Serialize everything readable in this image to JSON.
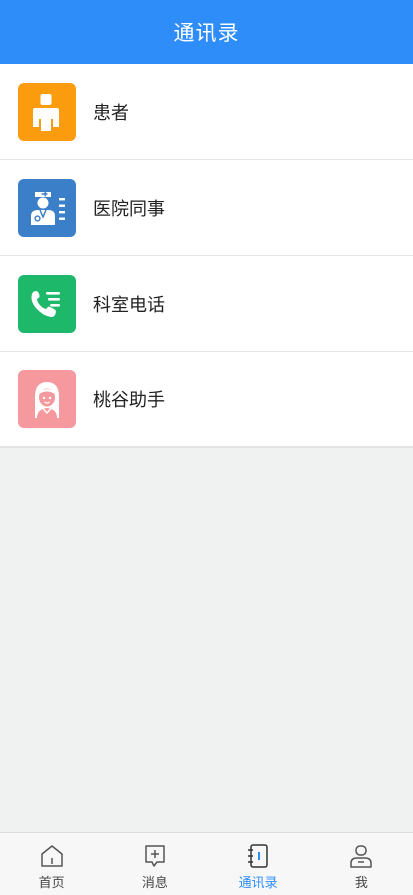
{
  "header": {
    "title": "通讯录"
  },
  "contacts": {
    "items": [
      {
        "label": "患者",
        "icon": "patient-icon",
        "color": "#fa9c0e"
      },
      {
        "label": "医院同事",
        "icon": "doctor-icon",
        "color": "#3a7fc8"
      },
      {
        "label": "科室电话",
        "icon": "phone-list-icon",
        "color": "#1db86a"
      },
      {
        "label": "桃谷助手",
        "icon": "assistant-avatar-icon",
        "color": "#f5999e"
      }
    ]
  },
  "tabbar": {
    "items": [
      {
        "label": "首页",
        "icon": "home-icon",
        "active": false
      },
      {
        "label": "消息",
        "icon": "message-icon",
        "active": false
      },
      {
        "label": "通讯录",
        "icon": "contacts-book-icon",
        "active": true
      },
      {
        "label": "我",
        "icon": "profile-icon",
        "active": false
      }
    ],
    "active_color": "#2f8dfa",
    "inactive_color": "#444444"
  },
  "colors": {
    "header_bg": "#2f8dfa",
    "page_bg": "#f0f2f1"
  }
}
